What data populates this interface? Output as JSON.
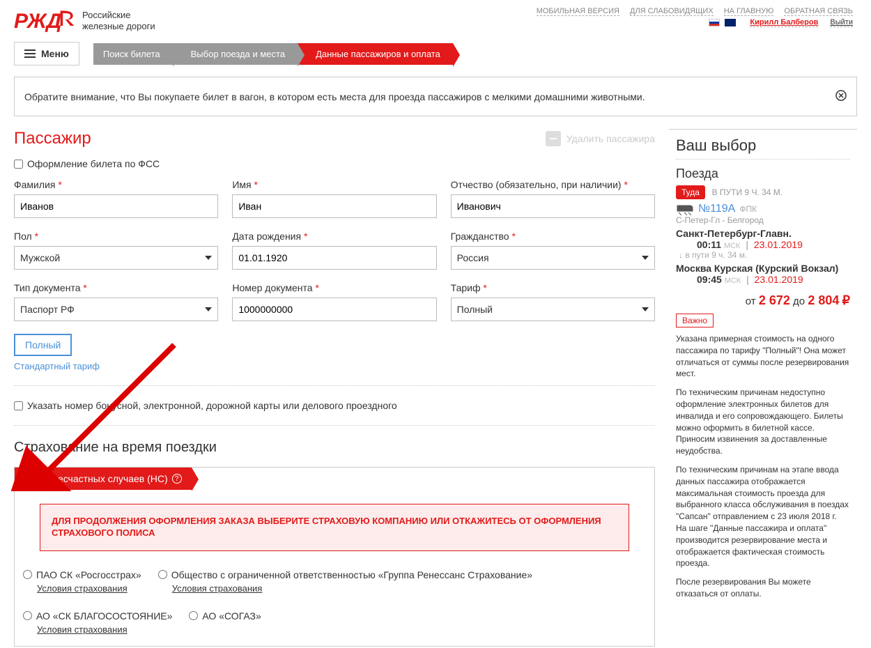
{
  "header": {
    "company_line1": "Российские",
    "company_line2": "железные дороги",
    "top_links": [
      "МОБИЛЬНАЯ ВЕРСИЯ",
      "ДЛЯ СЛАБОВИДЯЩИХ",
      "НА ГЛАВНУЮ",
      "ОБРАТНАЯ СВЯЗЬ"
    ],
    "user_name": "Кирилл Балберов",
    "logout": "Выйти",
    "menu": "Меню"
  },
  "breadcrumb": {
    "step1": "Поиск билета",
    "step2": "Выбор поезда и места",
    "step3": "Данные пассажиров и оплата"
  },
  "notice": "Обратите внимание, что Вы покупаете билет в вагон, в котором есть места для проезда пассажиров с мелкими домашними животными.",
  "passenger": {
    "title": "Пассажир",
    "delete": "Удалить пассажира",
    "fss_checkbox": "Оформление билета по ФСС",
    "labels": {
      "surname": "Фамилия",
      "name": "Имя",
      "patronymic": "Отчество (обязательно, при наличии)",
      "gender": "Пол",
      "dob": "Дата рождения",
      "citizenship": "Гражданство",
      "doc_type": "Тип документа",
      "doc_number": "Номер документа",
      "tariff": "Тариф"
    },
    "values": {
      "surname": "Иванов",
      "name": "Иван",
      "patronymic": "Иванович",
      "gender": "Мужской",
      "dob": "01.01.1920",
      "citizenship": "Россия",
      "doc_type": "Паспорт РФ",
      "doc_number": "1000000000",
      "tariff": "Полный"
    },
    "tariff_chip": "Полный",
    "tariff_note": "Стандартный тариф",
    "bonus_checkbox": "Указать номер бонусной, электронной, дорожной карты или делового проездного"
  },
  "insurance": {
    "title": "Страхование на время поездки",
    "ribbon": "От несчастных случаев (НС)",
    "warn": "ДЛЯ ПРОДОЛЖЕНИЯ ОФОРМЛЕНИЯ ЗАКАЗА ВЫБЕРИТЕ СТРАХОВУЮ КОМПАНИЮ ИЛИ ОТКАЖИТЕСЬ ОТ ОФОРМЛЕНИЯ СТРАХОВОГО ПОЛИСА",
    "options": [
      "ПАО СК «Росгосстрах»",
      "Общество с ограниченной ответственностью «Группа Ренессанс Страхование»",
      "АО «СК БЛАГОСОСТОЯНИЕ»",
      "АО «СОГАЗ»"
    ],
    "cond": "Условия страхования"
  },
  "sidebar": {
    "title": "Ваш выбор",
    "subtitle": "Поезда",
    "dir_badge": "Туда",
    "travel_top": "В ПУТИ 9 Ч. 34 М.",
    "train_num": "№119А",
    "train_co": "ФПК",
    "route": "С-Петер-Гл - Белгород",
    "dep_station": "Санкт-Петербург-Главн.",
    "dep_time": "00:11",
    "dep_date": "23.01.2019",
    "travel_mid": "в пути  9 ч. 34 м.",
    "arr_station": "Москва Курская (Курский Вокзал)",
    "arr_time": "09:45",
    "arr_date": "23.01.2019",
    "price_from_lbl": "от",
    "price_from": "2 672",
    "price_to_lbl": "до",
    "price_to": "2 804",
    "cur": "₽",
    "msk": "МСК",
    "important_badge": "Важно",
    "para1": "Указана примерная стоимость на одного пассажира по тарифу \"Полный\"! Она может отличаться от суммы после резервирования мест.",
    "para2": "По техническим причинам недоступно оформление электронных билетов для инвалида и его сопровождающего. Билеты можно оформить в билетной кассе. Приносим извинения за доставленные неудобства.",
    "para3": "По техническим причинам на этапе ввода данных пассажира отображается максимальная стоимость проезда для выбранного класса обслуживания в поездах \"Сапсан\" отправлением с 23 июля 2018 г.",
    "para3b": "На шаге \"Данные пассажира и оплата\" производится резервирование места и отображается фактическая стоимость проезда.",
    "para4": "После резервирования Вы можете отказаться от оплаты."
  }
}
